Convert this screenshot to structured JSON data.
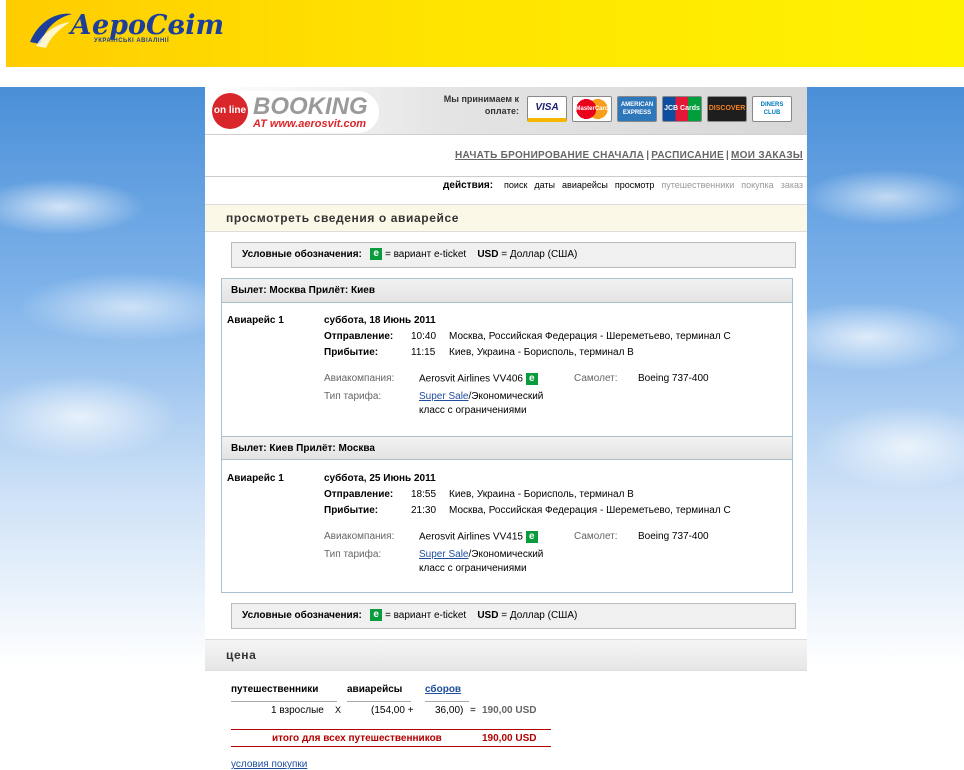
{
  "brand": {
    "logo_text": "АероСвіт",
    "logo_subtitle": "УКРАЇНСЬКІ АВІАЛІНІЇ",
    "brand_color": "#1b3f9a",
    "banner_color": "#ffe400"
  },
  "header": {
    "online_badge": "on line",
    "booking_word": "BOOKING",
    "booking_url": "AT www.aerosvit.com",
    "payment_label": "Мы принимаем к оплате:",
    "cards": [
      "VISA",
      "MasterCard",
      "AMERICAN EXPRESS",
      "JCB Cards",
      "DISCOVER",
      "DINERS CLUB"
    ]
  },
  "top_links": {
    "restart": "НАЧАТЬ БРОНИРОВАНИЕ СНАЧАЛА",
    "schedule": "РАСПИСАНИЕ",
    "my_orders": "МОИ ЗАКАЗЫ",
    "separator": "|"
  },
  "steps": {
    "label": "действия:",
    "items": [
      "поиск",
      "даты",
      "авиарейсы",
      "просмотр",
      "путешественники",
      "покупка",
      "заказ"
    ]
  },
  "section_title": "просмотреть сведения о авиарейсе",
  "legend": {
    "label": "Условные обозначения:",
    "e_badge": "e",
    "e_text": "= вариант e-ticket",
    "currency_code": "USD",
    "currency_text": "= Доллар (США)"
  },
  "labels": {
    "departure": "Отправление:",
    "arrival": "Прибытие:",
    "airline": "Авиакомпания:",
    "aircraft": "Самолет:",
    "fare_type": "Тип тарифа:"
  },
  "legs": [
    {
      "title": "Вылет: Москва Прилёт: Киев",
      "flight_label": "Авиарейс 1",
      "date": "суббота, 18 Июнь 2011",
      "dep_time": "10:40",
      "dep_place": "Москва, Российская Федерация - Шереметьево, терминал C",
      "arr_time": "11:15",
      "arr_place": "Киев, Украина - Борисполь, терминал B",
      "airline": "Aerosvit Airlines VV406",
      "aircraft": "Boeing 737-400",
      "fare_link": "Super Sale",
      "fare_rest_1": "/Экономический",
      "fare_rest_2": "класс с ограничениями"
    },
    {
      "title": "Вылет: Киев Прилёт: Москва",
      "flight_label": "Авиарейс 1",
      "date": "суббота, 25 Июнь 2011",
      "dep_time": "18:55",
      "dep_place": "Киев, Украина - Борисполь, терминал B",
      "arr_time": "21:30",
      "arr_place": "Москва, Российская Федерация - Шереметьево, терминал C",
      "airline": "Aerosvit Airlines VV415",
      "aircraft": "Boeing 737-400",
      "fare_link": "Super Sale",
      "fare_rest_1": "/Экономический",
      "fare_rest_2": "класс с ограничениями"
    }
  ],
  "price": {
    "title": "цена",
    "col_travelers": "путешественники",
    "col_flights": "авиарейсы",
    "col_fees": "сборов",
    "row_travelers": "1 взрослые",
    "row_times": "X",
    "row_fare": "(154,00 +",
    "row_fees": "36,00)",
    "row_eq": "=",
    "row_total": "190,00 USD",
    "total_label": "итого для всех путешественников",
    "total_value": "190,00 USD",
    "terms_link": "условия покупки"
  }
}
